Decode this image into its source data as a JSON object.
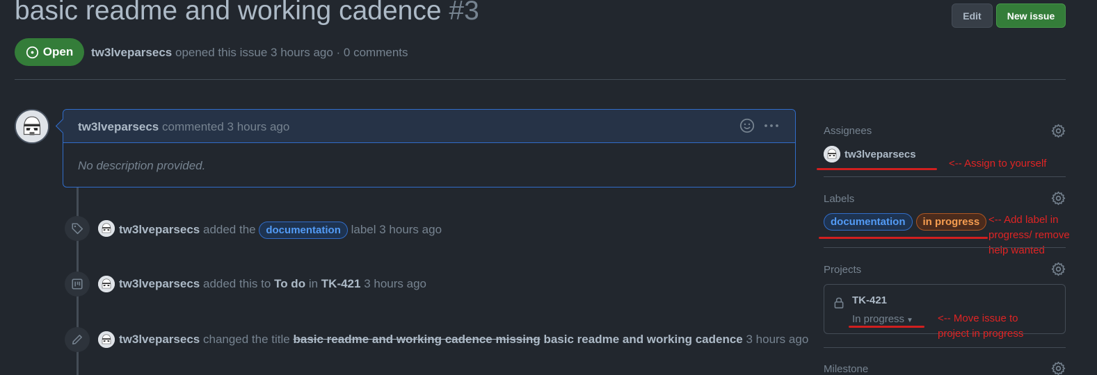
{
  "issue": {
    "title": "basic readme and working cadence",
    "number": "#3",
    "state": "Open",
    "author": "tw3lveparsecs",
    "opened_text": "opened this issue 3 hours ago · 0 comments"
  },
  "header_buttons": {
    "edit": "Edit",
    "new_issue": "New issue"
  },
  "comment": {
    "author": "tw3lveparsecs",
    "action": "commented 3 hours ago",
    "body": "No description provided."
  },
  "timeline": [
    {
      "author": "tw3lveparsecs",
      "pre": "added the",
      "label": "documentation",
      "post": "label 3 hours ago"
    },
    {
      "author": "tw3lveparsecs",
      "pre": "added this to",
      "column": "To do",
      "mid": "in",
      "project": "TK-421",
      "post": "3 hours ago"
    },
    {
      "author": "tw3lveparsecs",
      "pre": "changed the title",
      "old_title": "basic readme and working cadence missing",
      "new_title": "basic readme and working cadence",
      "post": "3 hours ago"
    }
  ],
  "sidebar": {
    "assignees": {
      "heading": "Assignees",
      "user": "tw3lveparsecs"
    },
    "labels": {
      "heading": "Labels",
      "items": [
        "documentation",
        "in progress"
      ]
    },
    "projects": {
      "heading": "Projects",
      "name": "TK-421",
      "status": "In progress"
    },
    "milestone": {
      "heading": "Milestone"
    }
  },
  "annotations": {
    "assign": "<-- Assign to yourself",
    "labels_line1": "<-- Add label in",
    "labels_line2": "progress/ remove",
    "labels_line3": "help wanted",
    "project_line1": "<-- Move issue to",
    "project_line2": "project in progress"
  },
  "colors": {
    "background": "#22272e",
    "open_green": "#347d39",
    "annotation_red": "#e02424",
    "label_documentation": "#539bf5",
    "label_in_progress": "#f69d50"
  }
}
